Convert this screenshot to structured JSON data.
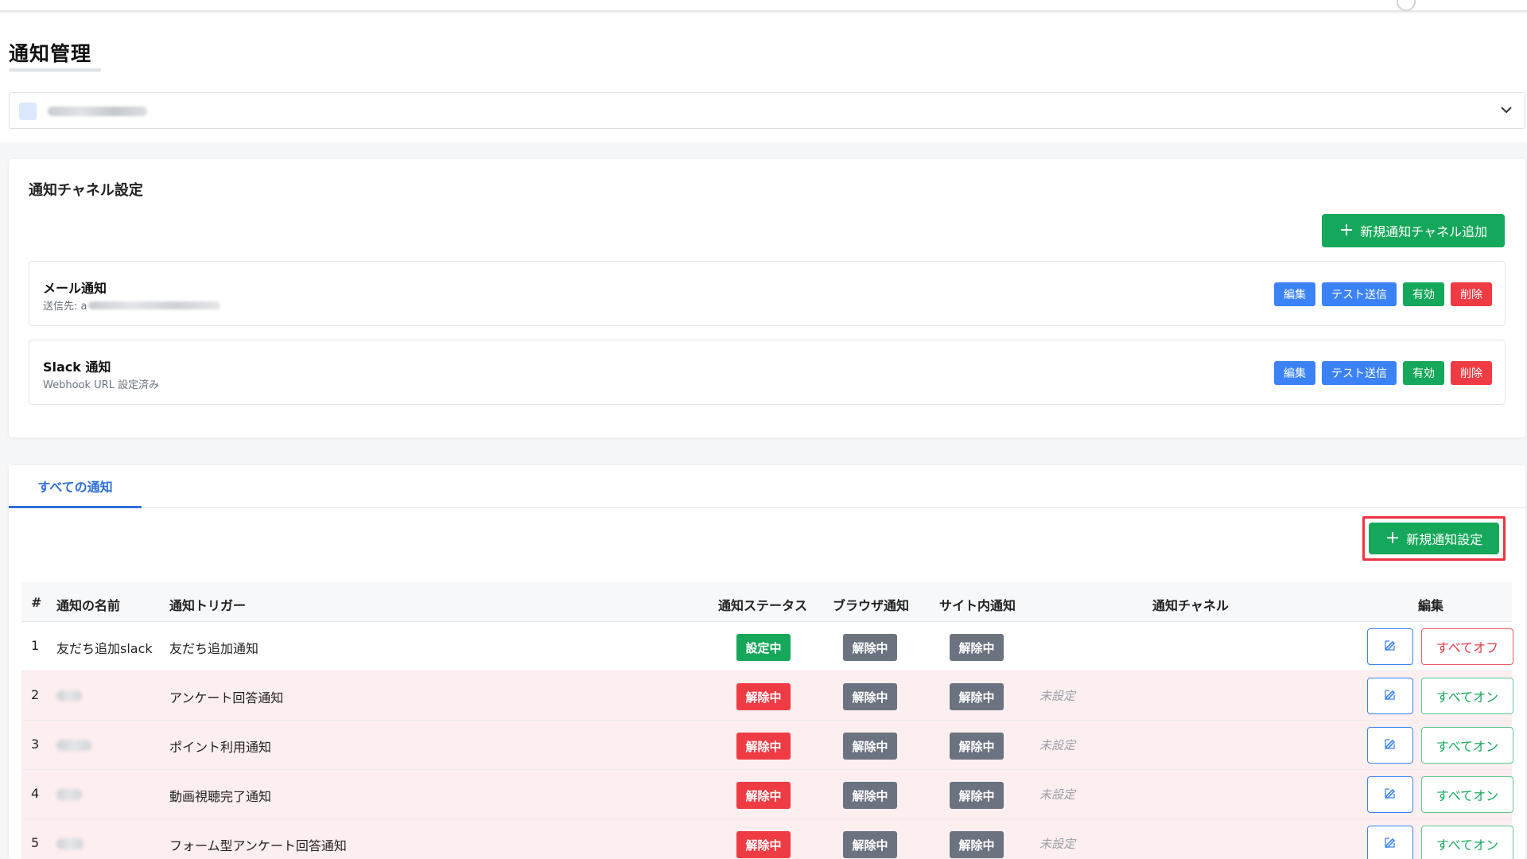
{
  "page": {
    "title": "通知管理",
    "colors": {
      "accent": "#16a85a",
      "link": "#2f6fd6",
      "danger": "#ef3b43",
      "info": "#3b82f6",
      "muted": "#6b7280"
    }
  },
  "site_select": {
    "icon": "chevron-down-icon"
  },
  "channel_settings": {
    "title": "通知チャネル設定",
    "add_button": "新規通知チャネル追加",
    "channels": [
      {
        "name": "メール通知",
        "sub_prefix": "送信先: a",
        "actions": [
          "編集",
          "テスト送信",
          "有効",
          "削除"
        ]
      },
      {
        "name": "Slack 通知",
        "sub": "Webhook URL 設定済み",
        "actions": [
          "編集",
          "テスト送信",
          "有効",
          "削除"
        ]
      }
    ]
  },
  "notifications": {
    "tab_label": "すべての通知",
    "add_button": "新規通知設定",
    "columns": [
      "#",
      "通知の名前",
      "通知トリガー",
      "通知ステータス",
      "ブラウザ通知",
      "サイト内通知",
      "通知チャネル",
      "編集"
    ],
    "rows": [
      {
        "no": "1",
        "name": "友だち追加slack",
        "trigger": "友だち追加通知",
        "status": "設定中",
        "browser": "解除中",
        "site": "解除中",
        "channel": "",
        "toggle": "すべてオフ"
      },
      {
        "no": "2",
        "name": "",
        "trigger": "アンケート回答通知",
        "status": "解除中",
        "browser": "解除中",
        "site": "解除中",
        "channel": "未設定",
        "toggle": "すべてオン"
      },
      {
        "no": "3",
        "name": "",
        "trigger": "ポイント利用通知",
        "status": "解除中",
        "browser": "解除中",
        "site": "解除中",
        "channel": "未設定",
        "toggle": "すべてオン"
      },
      {
        "no": "4",
        "name": "",
        "trigger": "動画視聴完了通知",
        "status": "解除中",
        "browser": "解除中",
        "site": "解除中",
        "channel": "未設定",
        "toggle": "すべてオン"
      },
      {
        "no": "5",
        "name": "",
        "trigger": "フォーム型アンケート回答通知",
        "status": "解除中",
        "browser": "解除中",
        "site": "解除中",
        "channel": "未設定",
        "toggle": "すべてオン"
      }
    ]
  }
}
